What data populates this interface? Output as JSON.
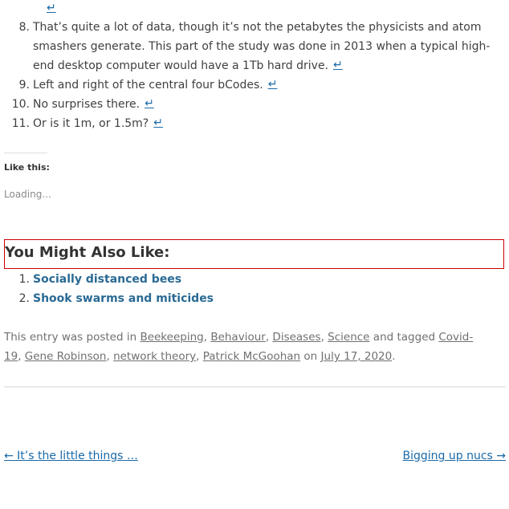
{
  "footnotes": {
    "return_symbol": "↵",
    "items": [
      {
        "number": "8.",
        "text": "That’s quite a lot of data, though it’s not the petabytes the physicists and atom smashers generate. This part of the study was done in 2013 when a typical high-end desktop computer would have a 1Tb hard drive."
      },
      {
        "number": "9.",
        "text": "Left and right of the central four bCodes."
      },
      {
        "number": "10.",
        "text": "No surprises there."
      },
      {
        "number": "11.",
        "text": "Or is it 1m, or 1.5m?"
      }
    ]
  },
  "like": {
    "heading": "Like this:",
    "loading": "Loading..."
  },
  "related": {
    "heading": "You Might Also Like:",
    "items": [
      {
        "number": "1.",
        "label": "Socially distanced bees"
      },
      {
        "number": "2.",
        "label": "Shook swarms and miticides"
      }
    ]
  },
  "entry_meta": {
    "posted_prefix": "This entry was posted in",
    "categories": [
      "Beekeeping",
      "Behaviour",
      "Diseases",
      "Science"
    ],
    "tagged_prefix": "and tagged",
    "tags": [
      "Covid-19",
      "Gene Robinson",
      "network theory",
      "Patrick McGoohan"
    ],
    "on_prefix": "on",
    "date": "July 17, 2020",
    "end": "."
  },
  "post_nav": {
    "prev": "← It’s the little things …",
    "next": "Bigging up nucs →"
  },
  "colors": {
    "link": "#1a6aa8",
    "related_link": "#2a6a94",
    "highlight_border": "#cc0000",
    "meta_text": "#707070"
  }
}
